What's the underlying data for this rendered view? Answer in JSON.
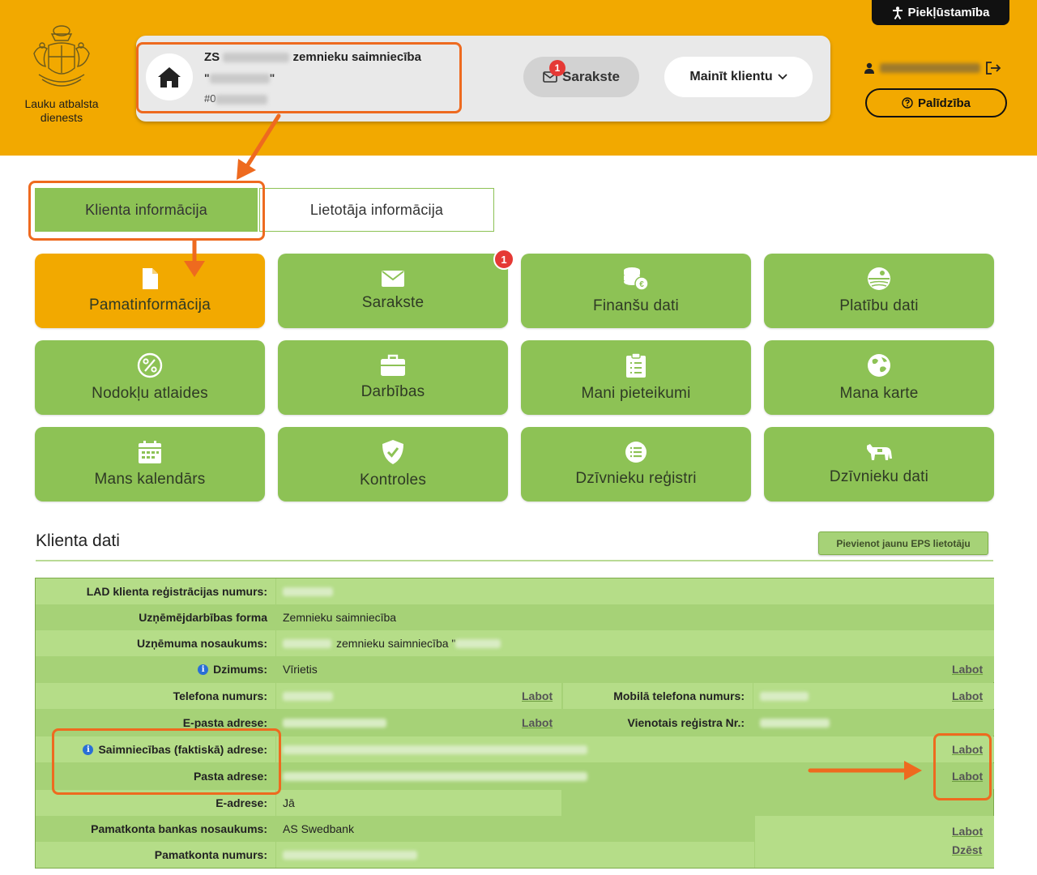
{
  "header": {
    "logo_line1": "Lauku atbalsta",
    "logo_line2": "dienests",
    "accessibility_label": "Piekļūstamība",
    "help_label": "Palīdzība"
  },
  "client": {
    "prefix": "ZS",
    "name_suffix": "zemnieku saimniecība",
    "quote_open": "\"",
    "quote_close": "\"",
    "id_prefix": "#0"
  },
  "toolbar": {
    "messages_label": "Sarakste",
    "messages_badge": "1",
    "change_client_label": "Mainīt klientu"
  },
  "tabs": [
    {
      "label": "Klienta informācija",
      "active": true
    },
    {
      "label": "Lietotāja informācija",
      "active": false
    }
  ],
  "tiles": [
    {
      "label": "Pamatinformācija",
      "icon": "document-icon",
      "active": true
    },
    {
      "label": "Sarakste",
      "icon": "envelope-icon",
      "badge": "1"
    },
    {
      "label": "Finanšu dati",
      "icon": "coins-euro-icon"
    },
    {
      "label": "Platību dati",
      "icon": "field-icon"
    },
    {
      "label": "Nodokļu atlaides",
      "icon": "percent-icon"
    },
    {
      "label": "Darbības",
      "icon": "briefcase-icon"
    },
    {
      "label": "Mani pieteikumi",
      "icon": "clipboard-list-icon"
    },
    {
      "label": "Mana karte",
      "icon": "globe-icon"
    },
    {
      "label": "Mans kalendārs",
      "icon": "calendar-icon"
    },
    {
      "label": "Kontroles",
      "icon": "shield-check-icon"
    },
    {
      "label": "Dzīvnieku reģistri",
      "icon": "list-circle-icon"
    },
    {
      "label": "Dzīvnieku dati",
      "icon": "cow-icon"
    }
  ],
  "section": {
    "title": "Klienta dati",
    "add_user_button": "Pievienot jaunu EPS lietotāju"
  },
  "fields": {
    "reg_number_label": "LAD klienta reģistrācijas numurs:",
    "business_form_label": "Uzņēmējdarbības forma",
    "business_form_value": "Zemnieku saimniecība",
    "company_name_label": "Uzņēmuma nosaukums:",
    "company_name_value": "zemnieku saimniecība \"",
    "gender_label": "Dzimums:",
    "gender_value": "Vīrietis",
    "phone_label": "Telefona numurs:",
    "mobile_label": "Mobilā telefona numurs:",
    "email_label": "E-pasta adrese:",
    "unified_reg_label": "Vienotais reģistra Nr.:",
    "farm_address_label": "Saimniecības (faktiskā) adrese:",
    "postal_address_label": "Pasta adrese:",
    "eaddress_label": "E-adrese:",
    "eaddress_value": "Jā",
    "bank_name_label": "Pamatkonta bankas nosaukums:",
    "bank_name_value": "AS Swedbank",
    "account_label": "Pamatkonta numurs:"
  },
  "actions": {
    "edit": "Labot",
    "delete": "Dzēst"
  },
  "colors": {
    "header_bg": "#f2a900",
    "tile_green": "#8dc255",
    "tile_active": "#f2a900",
    "annotation": "#ee6a1f",
    "badge_red": "#e53935"
  }
}
